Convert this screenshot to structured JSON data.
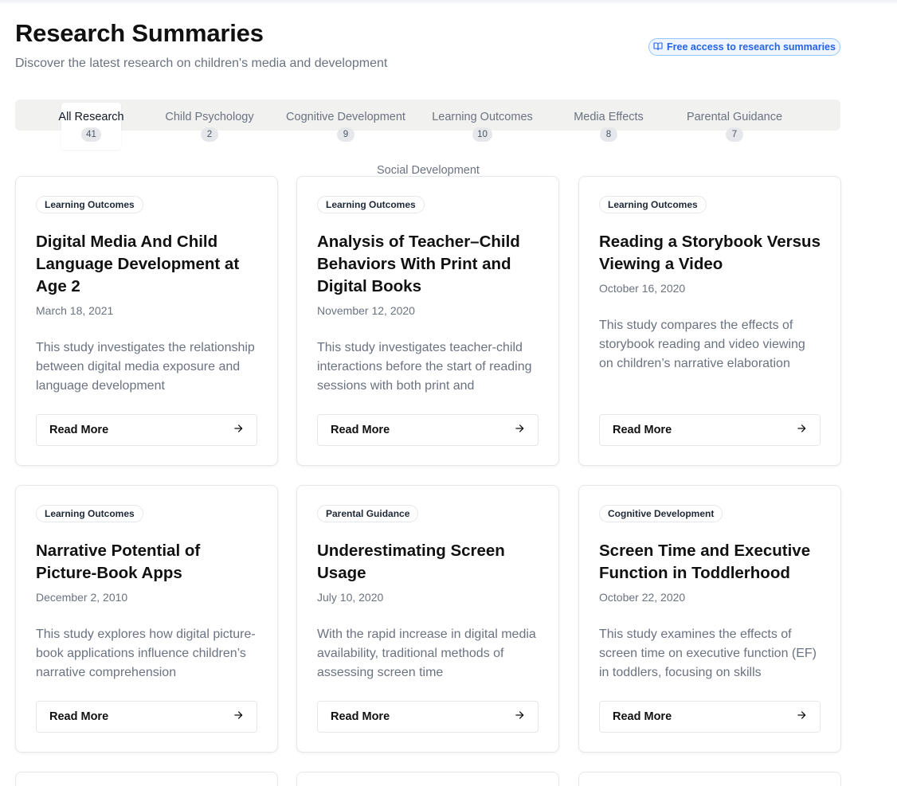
{
  "header": {
    "title": "Research Summaries",
    "subtitle": "Discover the latest research on children's media and development",
    "access_badge": "Free access to research summaries",
    "access_icon": "book-open-icon"
  },
  "tabs": [
    {
      "label": "All Research",
      "count": "41",
      "active": true
    },
    {
      "label": "Child Psychology",
      "count": "2"
    },
    {
      "label": "Cognitive Development",
      "count": "9"
    },
    {
      "label": "Learning Outcomes",
      "count": "10"
    },
    {
      "label": "Media Effects",
      "count": "8"
    },
    {
      "label": "Parental Guidance",
      "count": "7"
    },
    {
      "label": "Social Development",
      "count": ""
    }
  ],
  "cards": [
    {
      "tag": "Learning Outcomes",
      "title": "Digital Media And Child Language Development at Age 2",
      "date": "March 18, 2021",
      "description": "This study investigates the relationship between digital media exposure and language development",
      "button": "Read More"
    },
    {
      "tag": "Learning Outcomes",
      "title": "Analysis of Teacher–Child Behaviors With Print and Digital Books",
      "date": "November 12, 2020",
      "description": "This study investigates teacher-child interactions before the start of reading sessions with both print and",
      "button": "Read More"
    },
    {
      "tag": "Learning Outcomes",
      "title": "Reading a Storybook Versus Viewing a Video",
      "date": "October 16, 2020",
      "description": "This study compares the effects of storybook reading and video viewing on children’s narrative elaboration",
      "button": "Read More"
    },
    {
      "tag": "Learning Outcomes",
      "title": "Narrative Potential of Picture-Book Apps",
      "date": "December 2, 2010",
      "description": "This study explores how digital picture-book applications influence children’s narrative comprehension",
      "button": "Read More"
    },
    {
      "tag": "Parental Guidance",
      "title": "Underestimating Screen Usage",
      "date": "July 10, 2020",
      "description": "With the rapid increase in digital media availability, traditional methods of assessing screen time",
      "button": "Read More"
    },
    {
      "tag": "Cognitive Development",
      "title": "Screen Time and Executive Function in Toddlerhood",
      "date": "October 22, 2020",
      "description": "This study examines the effects of screen time on executive function (EF) in toddlers, focusing on skills",
      "button": "Read More"
    }
  ],
  "colors": {
    "accent": "#2563eb",
    "tab_bar": "#f1f1f0",
    "muted_text": "#6b7280"
  }
}
